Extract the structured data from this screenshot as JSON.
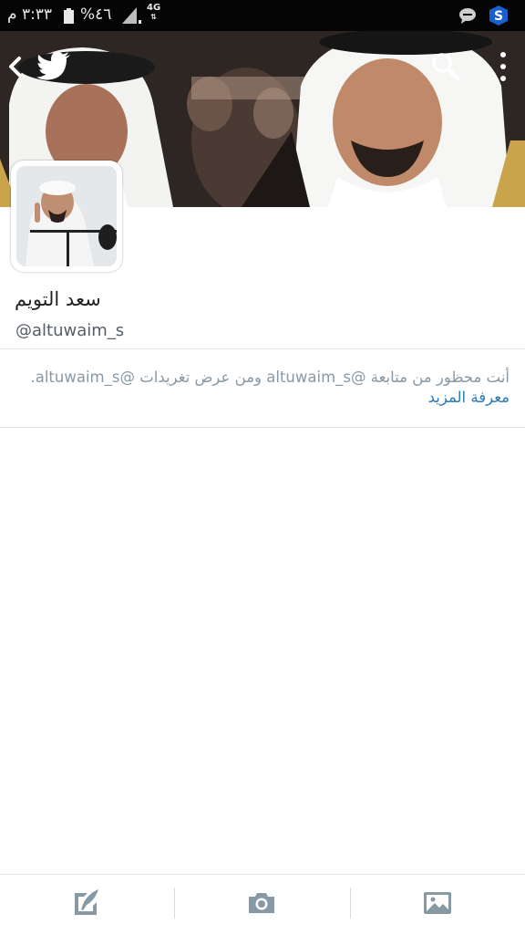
{
  "status_bar": {
    "time": "٣:٣٣ م",
    "battery": "%٤٦",
    "network": "4G"
  },
  "header": {
    "icons": [
      "back-chevron-icon",
      "twitter-bird-icon",
      "search-icon",
      "overflow-menu-icon"
    ]
  },
  "profile": {
    "name": "سعد التويم",
    "handle": "@altuwaim_s"
  },
  "blocked_notice": {
    "message": "أنت محظور من متابعة @altuwaim_s ومن عرض تغريدات @altuwaim_s.",
    "learn_more": "معرفة المزيد"
  },
  "toolbar": {
    "icons": [
      "compose-tweet-icon",
      "camera-icon",
      "image-icon"
    ]
  },
  "colors": {
    "link": "#2b7bb9",
    "muted_text": "#8899a6",
    "toolbar_icon": "#8899a6",
    "status_bar": "#050505"
  }
}
